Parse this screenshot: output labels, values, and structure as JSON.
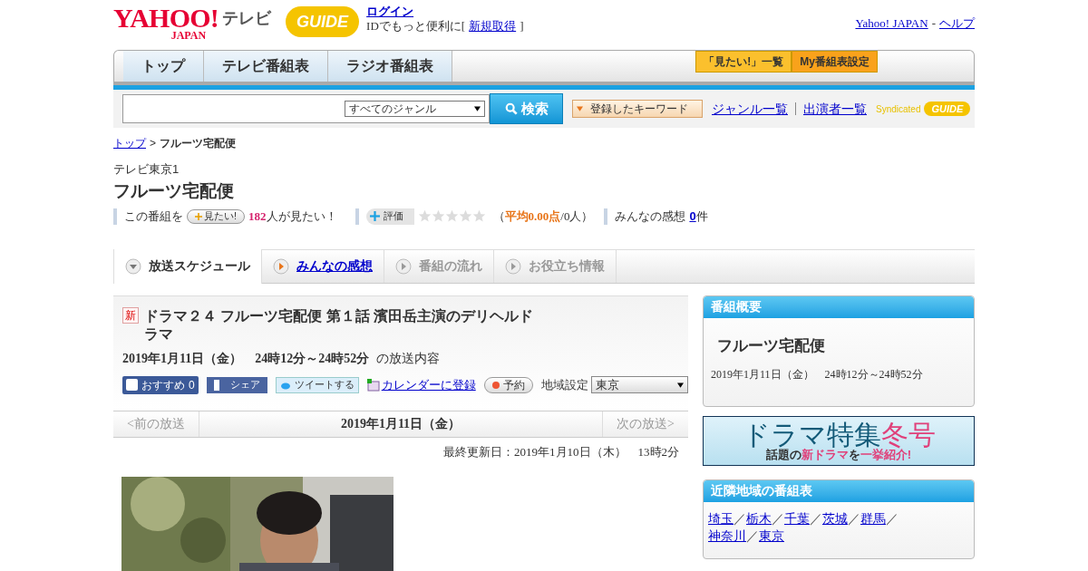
{
  "header": {
    "logo_main": "YAHOO!",
    "logo_sub": "JAPAN",
    "logo_service": "テレビ",
    "guide_logo": "GUIDE",
    "login_link": "ログイン",
    "id_text_before": "IDでもっと便利に[",
    "signup_link": "新規取得",
    "id_text_after": "]",
    "yahoo_link": "Yahoo! JAPAN",
    "separator": "-",
    "help_link": "ヘルプ"
  },
  "nav": {
    "tabs": [
      {
        "label": "トップ",
        "selected": false
      },
      {
        "label": "テレビ番組表",
        "selected": false
      },
      {
        "label": "ラジオ番組表",
        "selected": false
      }
    ],
    "buttons": [
      "「見たい!」一覧",
      "My番組表設定"
    ]
  },
  "search": {
    "genre": "すべてのジャンル",
    "button": "検索",
    "keywords": "登録したキーワード",
    "links": [
      "ジャンル一覧",
      "出演者一覧"
    ],
    "syndicated": "Syndicated",
    "guide_logo": "GUIDE"
  },
  "breadcrumb": {
    "home": "トップ",
    "separator": ">",
    "current": "フルーツ宅配便"
  },
  "channel": "テレビ東京1",
  "title": "フルーツ宅配便",
  "stats": {
    "want_label": "この番組を",
    "want_button": "見たい!",
    "want_count": "182",
    "want_suffix": "人が見たい！",
    "rate_button": "評価",
    "stars": 0,
    "average_open": "（",
    "average": "平均0.00点",
    "average_close": "/0人）",
    "comments_label": "みんなの感想",
    "comments_count": "0",
    "comments_suffix": "件"
  },
  "section_tabs": [
    {
      "label": "放送スケジュール",
      "selected": true,
      "disabled": false
    },
    {
      "label": "みんなの感想",
      "selected": false,
      "disabled": false
    },
    {
      "label": "番組の流れ",
      "selected": false,
      "disabled": true
    },
    {
      "label": "お役立ち情報",
      "selected": false,
      "disabled": true
    }
  ],
  "episode": {
    "new_badge": "新",
    "title": "ドラマ２４ フルーツ宅配便 第１話 濱田岳主演のデリヘルドラマ",
    "airtime": "2019年1月11日（金）　24時12分～24時52分",
    "airtime_suffix": "の放送内容",
    "recommend": "おすすめ",
    "recommend_count": "0",
    "share": "シェア",
    "tweet": "ツイートする",
    "calendar": "カレンダーに登録",
    "reserve": "予約",
    "region_label": "地域設定",
    "region": "東京"
  },
  "pager": {
    "prev": "<前の放送",
    "date": "2019年1月11日（金）",
    "next": "次の放送>"
  },
  "updated": "最終更新日：2019年1月10日（木）　13時2分",
  "sidebar": {
    "summary": {
      "heading": "番組概要",
      "title": "フルーツ宅配便",
      "airtime": "2019年1月11日（金）　24時12分～24時52分"
    },
    "banner": {
      "title_before": "ドラマ特集",
      "title_accent": "冬号",
      "sub_1": "話題の",
      "sub_2": "新ドラマ",
      "sub_3": "を",
      "sub_4": "一挙紹介!"
    },
    "nearby": {
      "heading": "近隣地域の番組表",
      "regions": [
        "埼玉",
        "栃木",
        "千葉",
        "茨城",
        "群馬",
        "神奈川",
        "東京"
      ],
      "separator": "／"
    }
  }
}
